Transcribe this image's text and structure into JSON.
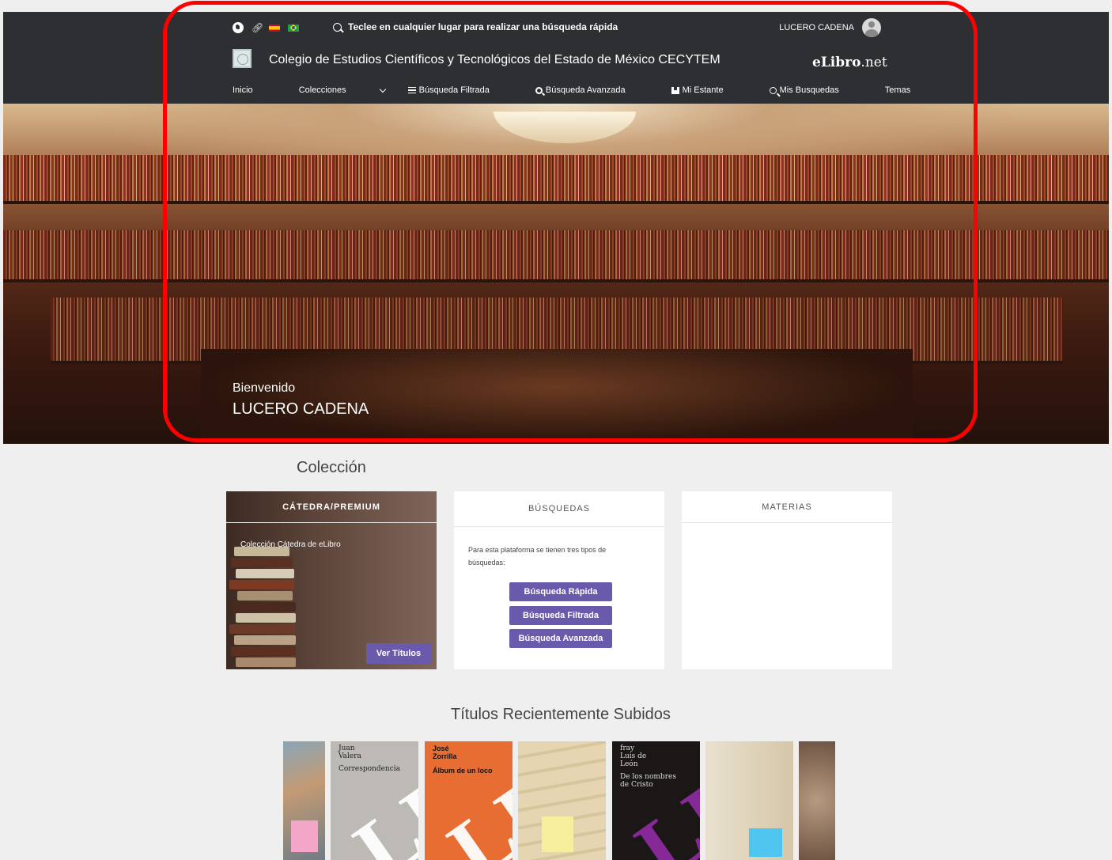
{
  "header": {
    "search_hint": "Teclee en cualquier lugar para realizar una búsqueda rápida",
    "user_name": "LUCERO CADENA",
    "institution": "Colegio de Estudios Científicos y Tecnológicos del Estado de México CECYTEM",
    "brand": "eLibro",
    "brand_suffix": ".net",
    "icons": [
      "globe-icon",
      "link-icon",
      "flag-spain-icon",
      "flag-brazil-icon"
    ]
  },
  "nav": {
    "items": [
      {
        "label": "Inicio"
      },
      {
        "label": "Colecciones"
      },
      {
        "label": "Búsqueda Filtrada"
      },
      {
        "label": "Búsqueda Avanzada"
      },
      {
        "label": "Mi Estante"
      },
      {
        "label": "Mis Busquedas"
      },
      {
        "label": "Temas"
      }
    ]
  },
  "hero": {
    "greeting": "Bienvenido",
    "name": "LUCERO CADENA"
  },
  "collection": {
    "title": "Colección",
    "premium": {
      "heading": "CÁTEDRA/PREMIUM",
      "description": "Colección Cátedra de eLibro",
      "button": "Ver Títulos"
    },
    "busquedas": {
      "heading": "BÚSQUEDAS",
      "description": "Para esta plataforma se tienen tres tipos de búsquedas:",
      "buttons": [
        "Búsqueda Rápida",
        "Búsqueda Filtrada",
        "Búsqueda Avanzada"
      ]
    },
    "materias": {
      "heading": "MATERIAS"
    }
  },
  "recent": {
    "title": "Títulos Recientemente Subidos",
    "books": [
      {
        "author": "",
        "title": ""
      },
      {
        "author": "Juan Valera",
        "title": "Correspondencia"
      },
      {
        "author": "José Zorrilla",
        "title": "Álbum de un loco"
      },
      {
        "author": "",
        "title": ""
      },
      {
        "author": "fray Luis de León",
        "title": "De los nombres de Cristo"
      },
      {
        "author": "",
        "title": ""
      },
      {
        "author": "",
        "title": ""
      }
    ]
  },
  "colors": {
    "header_bg": "#2e2f33",
    "accent_button": "#6a5aab",
    "highlight": "#ff0000",
    "page_bg": "#efefef"
  }
}
